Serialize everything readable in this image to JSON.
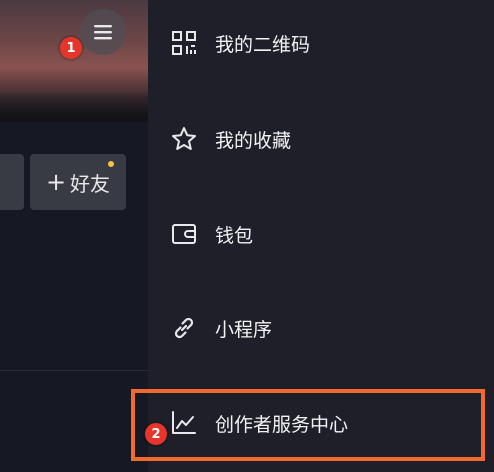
{
  "profile": {
    "add_friend_label": "好友",
    "add_friend_plus": "+"
  },
  "badges": {
    "one": "1",
    "two": "2"
  },
  "drawer": {
    "items": [
      {
        "label": "我的二维码",
        "icon": "qr-code-icon"
      },
      {
        "label": "我的收藏",
        "icon": "star-icon"
      },
      {
        "label": "钱包",
        "icon": "wallet-icon"
      },
      {
        "label": "小程序",
        "icon": "link-icon"
      },
      {
        "label": "创作者服务中心",
        "icon": "chart-trend-icon"
      }
    ]
  },
  "colors": {
    "background": "#161823",
    "drawer": "#1e1f29",
    "highlight": "#f26a2e",
    "badge": "#e8352b",
    "button": "#393b44"
  }
}
